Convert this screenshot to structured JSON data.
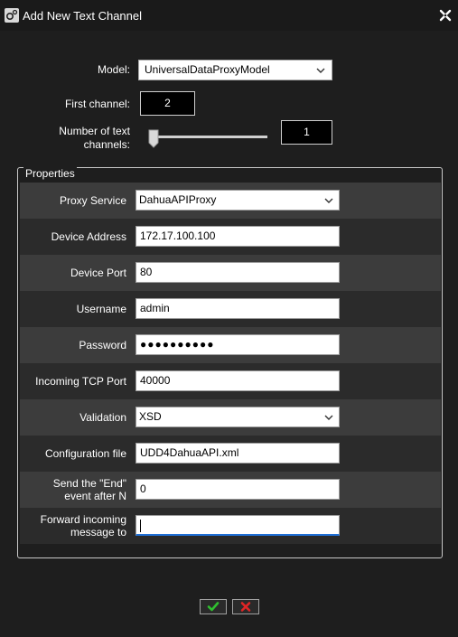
{
  "window": {
    "title": "Add New Text Channel"
  },
  "top": {
    "model_label": "Model:",
    "model_value": "UniversalDataProxyModel",
    "first_channel_label": "First channel:",
    "first_channel_value": "2",
    "num_channels_label_line1": "Number of text",
    "num_channels_label_line2": "channels:",
    "num_channels_value": "1",
    "num_channels_slider_position": 0
  },
  "properties": {
    "legend": "Properties",
    "rows": [
      {
        "label": "Proxy Service",
        "value": "DahuaAPIProxy",
        "type": "select"
      },
      {
        "label": "Device Address",
        "value": "172.17.100.100",
        "type": "text"
      },
      {
        "label": "Device Port",
        "value": "80",
        "type": "text"
      },
      {
        "label": "Username",
        "value": "admin",
        "type": "text"
      },
      {
        "label": "Password",
        "value": "●●●●●●●●●●",
        "type": "password"
      },
      {
        "label": "Incoming TCP Port",
        "value": "40000",
        "type": "text"
      },
      {
        "label": "Validation",
        "value": "XSD",
        "type": "select"
      },
      {
        "label": "Configuration file",
        "value": "UDD4DahuaAPI.xml",
        "type": "text"
      },
      {
        "label_line1": "Send the \"End\"",
        "label_line2": "event after N",
        "value": "0",
        "type": "text"
      },
      {
        "label_line1": "Forward incoming",
        "label_line2": "message to",
        "value": "",
        "type": "text-focused"
      }
    ]
  },
  "buttons": {
    "ok_icon": "checkmark-icon",
    "cancel_icon": "x-icon"
  },
  "colors": {
    "ok": "#2fbf2f",
    "cancel": "#e02525",
    "focus": "#1f6fd6",
    "background": "#1e1e1e"
  }
}
